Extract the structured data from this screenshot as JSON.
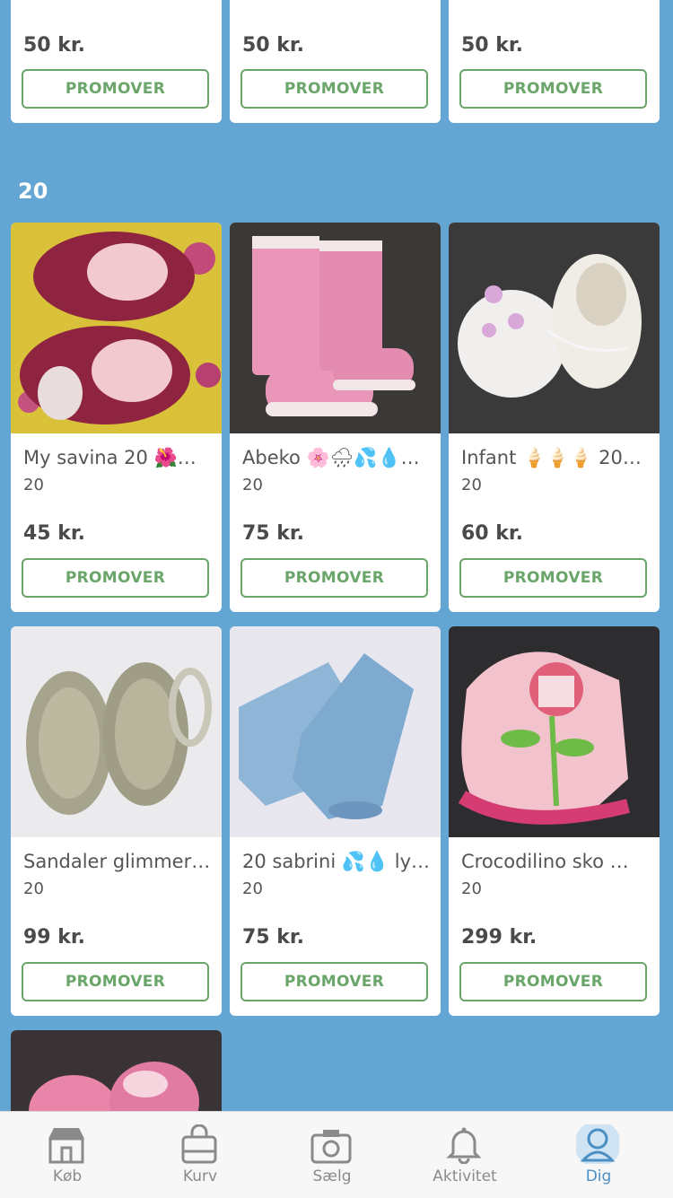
{
  "status_bar": {
    "battery_color": "#4cd964"
  },
  "top_row": [
    {
      "price": "50 kr.",
      "button": "PROMOVER"
    },
    {
      "price": "50 kr.",
      "button": "PROMOVER"
    },
    {
      "price": "50 kr.",
      "button": "PROMOVER"
    }
  ],
  "section": {
    "heading": "20"
  },
  "items": [
    {
      "title": "My savina 20 🌺🌺…",
      "size": "20",
      "price": "45 kr.",
      "button": "PROMOVER",
      "image_icon": "slipper-photo"
    },
    {
      "title": "Abeko 🌸🌧💦💧…",
      "size": "20",
      "price": "75 kr.",
      "button": "PROMOVER",
      "image_icon": "rain-boot-photo"
    },
    {
      "title": "Infant 🍦🍦🍦 20…",
      "size": "20",
      "price": "60 kr.",
      "button": "PROMOVER",
      "image_icon": "infant-shoe-photo"
    },
    {
      "title": "Sandaler glimmer…",
      "size": "20",
      "price": "99 kr.",
      "button": "PROMOVER",
      "image_icon": "sandal-photo"
    },
    {
      "title": "20 sabrini 💦💧 ly…",
      "size": "20",
      "price": "75 kr.",
      "button": "PROMOVER",
      "image_icon": "blue-boot-photo"
    },
    {
      "title": "Crocodilino sko 🌱…",
      "size": "20",
      "price": "299 kr.",
      "button": "PROMOVER",
      "image_icon": "flower-boot-photo"
    }
  ],
  "partial_item": {
    "image_icon": "pink-shoe-photo"
  },
  "tabbar": {
    "tabs": [
      {
        "label": "Køb",
        "icon": "shop-icon"
      },
      {
        "label": "Kurv",
        "icon": "bag-icon"
      },
      {
        "label": "Sælg",
        "icon": "camera-icon"
      },
      {
        "label": "Aktivitet",
        "icon": "bell-icon"
      },
      {
        "label": "Dig",
        "icon": "profile-icon"
      }
    ],
    "active_color": "#4a8fc4",
    "inactive_color": "#8a8a8a"
  },
  "colors": {
    "background": "#63a6d3",
    "accent_green": "#6aa56a"
  }
}
